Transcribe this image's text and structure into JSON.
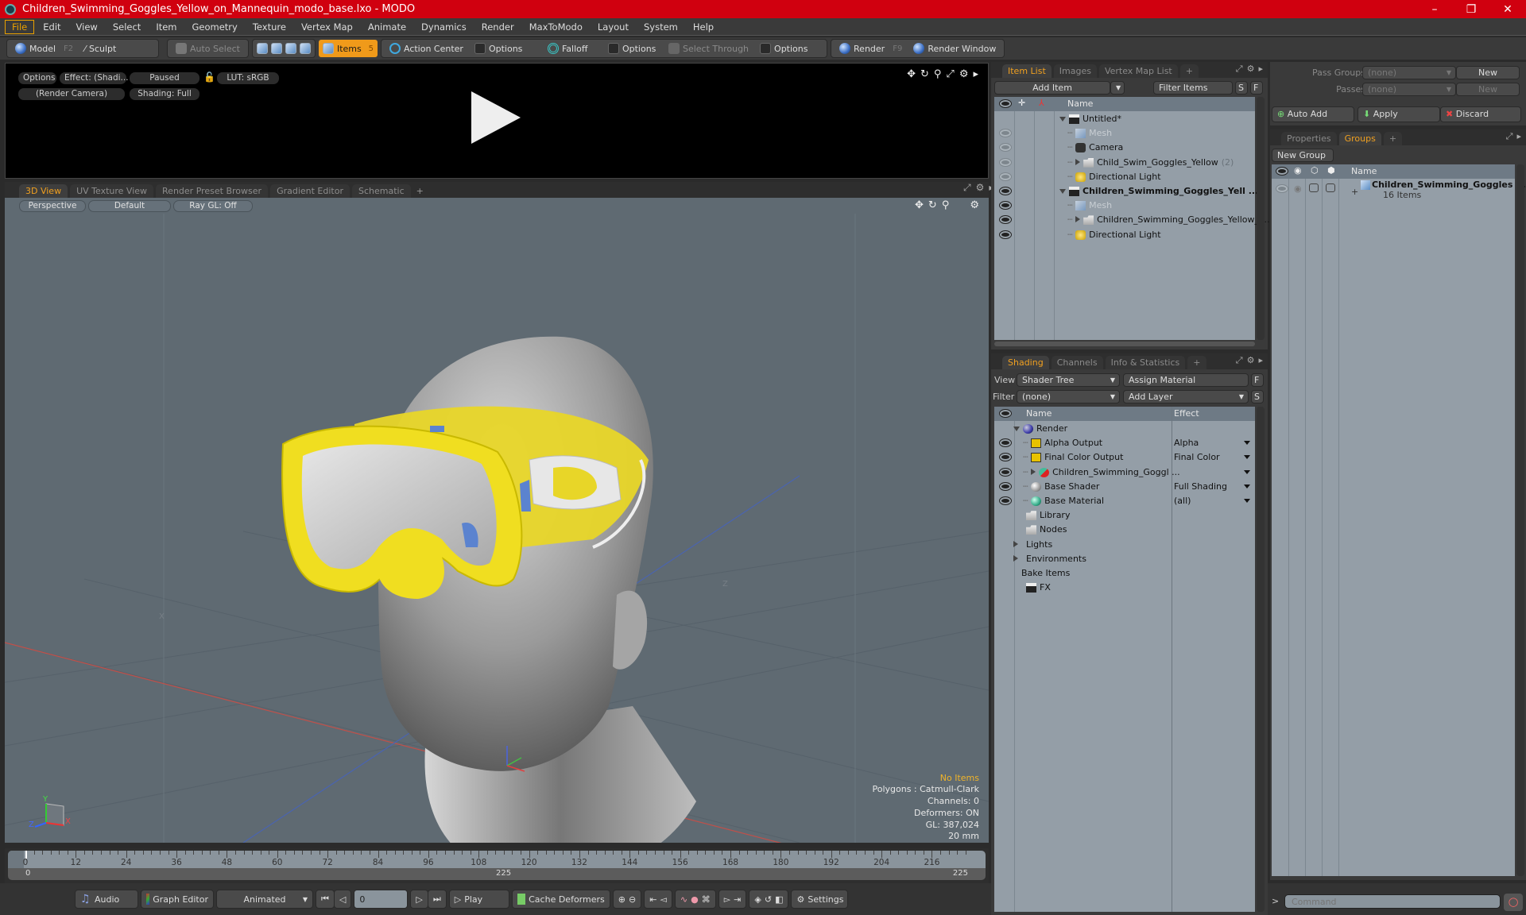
{
  "window": {
    "title": "Children_Swimming_Goggles_Yellow_on_Mannequin_modo_base.lxo - MODO",
    "controls": {
      "minimize": "–",
      "maximize": "❐",
      "close": "✕"
    }
  },
  "menu": [
    "File",
    "Edit",
    "View",
    "Select",
    "Item",
    "Geometry",
    "Texture",
    "Vertex Map",
    "Animate",
    "Dynamics",
    "Render",
    "MaxToModo",
    "Layout",
    "System",
    "Help"
  ],
  "toolbar": {
    "model": "Model",
    "model_key": "F2",
    "sculpt": "Sculpt",
    "auto_select": "Auto Select",
    "items": "Items",
    "items_key": "5",
    "action_center": "Action Center",
    "options1": "Options",
    "falloff": "Falloff",
    "options2": "Options",
    "select_through": "Select Through",
    "options3": "Options",
    "render": "Render",
    "render_key": "F9",
    "render_window": "Render Window"
  },
  "preview": {
    "options": "Options",
    "effect": "Effect: (Shadi...",
    "paused": "Paused",
    "lut": "LUT: sRGB",
    "camera": "(Render Camera)",
    "shading": "Shading: Full"
  },
  "viewport": {
    "tabs": [
      "3D View",
      "UV Texture View",
      "Render Preset Browser",
      "Gradient Editor",
      "Schematic"
    ],
    "active_tab": 0,
    "perspective": "Perspective",
    "style": "Default",
    "raygl": "Ray GL: Off",
    "stats": {
      "selection": "No Items",
      "polygons": "Polygons : Catmull-Clark",
      "channels": "Channels: 0",
      "deformers": "Deformers: ON",
      "gl": "GL: 387,024",
      "scale": "20 mm"
    },
    "axis_labels": {
      "x": "X",
      "y": "Y",
      "z": "Z",
      "grid_x": "X",
      "grid_z": "Z"
    }
  },
  "timeline": {
    "ticks": [
      "0",
      "12",
      "24",
      "36",
      "48",
      "60",
      "72",
      "84",
      "96",
      "108",
      "120",
      "132",
      "144",
      "156",
      "168",
      "180",
      "192",
      "204",
      "216"
    ],
    "range_start": "0",
    "range_end_a": "225",
    "range_end_b": "225",
    "current_frame": 0,
    "max_frame": 225
  },
  "bottombar": {
    "audio": "Audio",
    "graph_editor": "Graph Editor",
    "animated": "Animated",
    "frame": "0",
    "play": "Play",
    "cache_deformers": "Cache Deformers",
    "settings": "Settings"
  },
  "item_list": {
    "tabs": [
      "Item List",
      "Images",
      "Vertex Map List"
    ],
    "add_item": "Add Item",
    "filter_items": "Filter Items",
    "s": "S",
    "f": "F",
    "header_name": "Name",
    "rows": [
      {
        "label": "Untitled*",
        "level": 0,
        "icon": "scene",
        "expand": "open",
        "eye": "none",
        "style": "normal"
      },
      {
        "label": "Mesh",
        "level": 1,
        "icon": "mesh",
        "expand": "none",
        "eye": "dim",
        "style": "dim"
      },
      {
        "label": "Camera",
        "level": 1,
        "icon": "camera",
        "expand": "none",
        "eye": "dim",
        "style": "normal"
      },
      {
        "label": "Child_Swim_Goggles_Yellow",
        "count": "(2)",
        "level": 1,
        "icon": "folder",
        "expand": "closed",
        "eye": "dim",
        "style": "normal"
      },
      {
        "label": "Directional Light",
        "level": 1,
        "icon": "light",
        "expand": "none",
        "eye": "dim",
        "style": "normal"
      },
      {
        "label": "Children_Swimming_Goggles_Yell ...",
        "level": 0,
        "icon": "scene",
        "expand": "open",
        "eye": "on",
        "style": "bold"
      },
      {
        "label": "Mesh",
        "level": 1,
        "icon": "mesh",
        "expand": "none",
        "eye": "on",
        "style": "dim"
      },
      {
        "label": "Children_Swimming_Goggles_Yellow_o...",
        "level": 1,
        "icon": "folder",
        "expand": "closed",
        "eye": "on",
        "style": "normal"
      },
      {
        "label": "Directional Light",
        "level": 1,
        "icon": "light",
        "expand": "none",
        "eye": "on",
        "style": "normal"
      }
    ]
  },
  "shading": {
    "tabs": [
      "Shading",
      "Channels",
      "Info & Statistics"
    ],
    "view_label": "View",
    "view_value": "Shader Tree",
    "assign_material": "Assign Material",
    "f": "F",
    "filter_label": "Filter",
    "filter_value": "(none)",
    "add_layer": "Add Layer",
    "s": "S",
    "header_name": "Name",
    "header_effect": "Effect",
    "rows": [
      {
        "label": "Render",
        "level": 0,
        "icon": "render-sphere",
        "expand": "open",
        "eye": false,
        "effect": ""
      },
      {
        "label": "Alpha Output",
        "level": 1,
        "icon": "output",
        "expand": "none",
        "eye": true,
        "effect": "Alpha",
        "dropdown": true
      },
      {
        "label": "Final Color Output",
        "level": 1,
        "icon": "output",
        "expand": "none",
        "eye": true,
        "effect": "Final Color",
        "dropdown": true
      },
      {
        "label": "Children_Swimming_Goggl ...",
        "level": 1,
        "icon": "material-group",
        "expand": "closed",
        "eye": true,
        "effect": "",
        "dropdown": true
      },
      {
        "label": "Base Shader",
        "level": 1,
        "icon": "shader",
        "expand": "none",
        "eye": true,
        "effect": "Full Shading",
        "dropdown": true
      },
      {
        "label": "Base Material",
        "level": 1,
        "icon": "material",
        "expand": "none",
        "eye": true,
        "effect": "(all)",
        "dropdown": true
      },
      {
        "label": "Library",
        "level": 0,
        "icon": "folder",
        "expand": "none",
        "eye": false,
        "effect": ""
      },
      {
        "label": "Nodes",
        "level": 0,
        "icon": "folder",
        "expand": "none",
        "eye": false,
        "effect": ""
      },
      {
        "label": "Lights",
        "level": -1,
        "icon": "none",
        "expand": "closed",
        "eye": false,
        "effect": ""
      },
      {
        "label": "Environments",
        "level": -1,
        "icon": "none",
        "expand": "closed",
        "eye": false,
        "effect": ""
      },
      {
        "label": "Bake Items",
        "level": -1,
        "icon": "none",
        "expand": "none",
        "eye": false,
        "effect": ""
      },
      {
        "label": "FX",
        "level": 0,
        "icon": "scene",
        "expand": "none",
        "eye": false,
        "effect": ""
      }
    ]
  },
  "passes": {
    "pass_groups_label": "Pass Groups",
    "pass_groups_value": "(none)",
    "new1": "New",
    "passes_label": "Passes",
    "passes_value": "(none)",
    "new2": "New",
    "auto_add": "Auto Add",
    "apply": "Apply",
    "discard": "Discard"
  },
  "groups": {
    "tabs": [
      "Properties",
      "Groups"
    ],
    "new_group": "New Group",
    "header_name": "Name",
    "rows": [
      {
        "label": "Children_Swimming_Goggles ...",
        "sub": "16 Items"
      }
    ]
  },
  "command": {
    "placeholder": "Command",
    "prompt": ">"
  }
}
